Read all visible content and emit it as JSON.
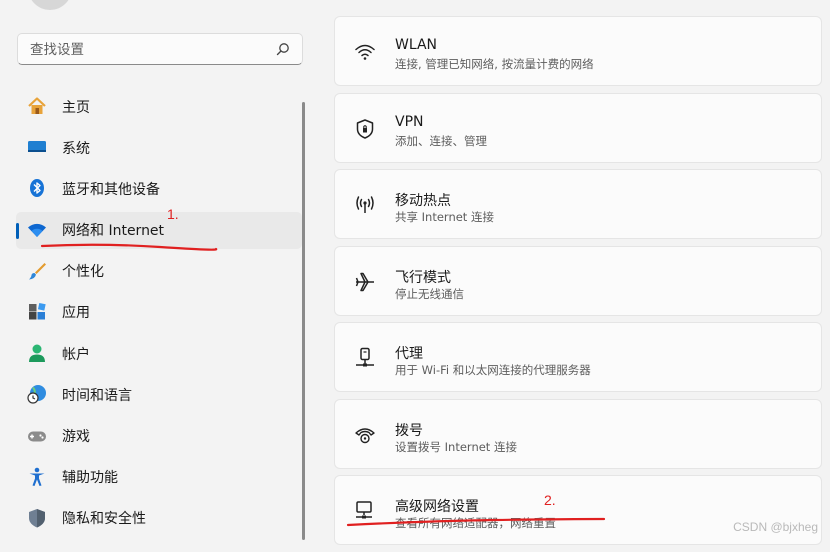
{
  "search": {
    "placeholder": "查找设置",
    "icon": "search-icon"
  },
  "sidebar": {
    "items": [
      {
        "label": "主页",
        "icon": "home-icon"
      },
      {
        "label": "系统",
        "icon": "system-icon"
      },
      {
        "label": "蓝牙和其他设备",
        "icon": "bluetooth-icon"
      },
      {
        "label": "网络和 Internet",
        "icon": "wifi-icon",
        "active": true
      },
      {
        "label": "个性化",
        "icon": "brush-icon"
      },
      {
        "label": "应用",
        "icon": "apps-icon"
      },
      {
        "label": "帐户",
        "icon": "account-icon"
      },
      {
        "label": "时间和语言",
        "icon": "time-language-icon"
      },
      {
        "label": "游戏",
        "icon": "gamepad-icon"
      },
      {
        "label": "辅助功能",
        "icon": "accessibility-icon"
      },
      {
        "label": "隐私和安全性",
        "icon": "shield-icon"
      }
    ]
  },
  "main": {
    "cards": [
      {
        "title": "WLAN",
        "subtitle": "连接, 管理已知网络, 按流量计费的网络",
        "icon": "wifi-icon"
      },
      {
        "title": "VPN",
        "subtitle": "添加、连接、管理",
        "icon": "vpn-shield-icon"
      },
      {
        "title": "移动热点",
        "subtitle": "共享 Internet 连接",
        "icon": "hotspot-icon"
      },
      {
        "title": "飞行模式",
        "subtitle": "停止无线通信",
        "icon": "airplane-icon"
      },
      {
        "title": "代理",
        "subtitle": "用于 Wi-Fi 和以太网连接的代理服务器",
        "icon": "proxy-icon"
      },
      {
        "title": "拨号",
        "subtitle": "设置拨号 Internet 连接",
        "icon": "dialup-icon"
      },
      {
        "title": "高级网络设置",
        "subtitle": "查看所有网络适配器，网络重置",
        "icon": "advanced-network-icon"
      }
    ]
  },
  "annotations": {
    "label_1": "1.",
    "label_2": "2."
  },
  "watermark": "CSDN @bjxheg",
  "colors": {
    "accent": "#005fb8",
    "annotation": "#e02020"
  }
}
